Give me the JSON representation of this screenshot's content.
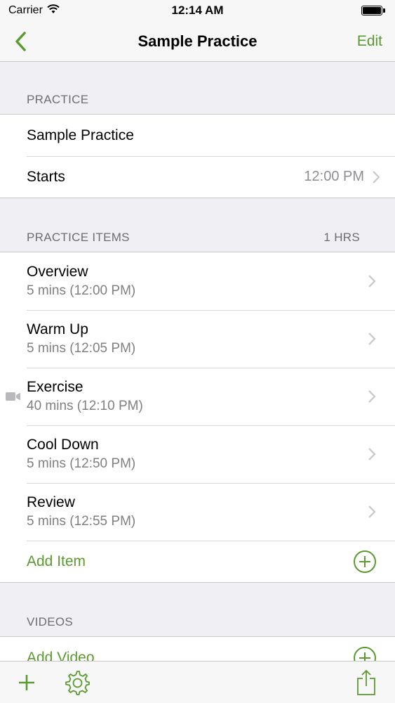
{
  "status_bar": {
    "carrier": "Carrier",
    "time": "12:14 AM"
  },
  "nav": {
    "title": "Sample Practice",
    "edit_label": "Edit"
  },
  "practice_section": {
    "header": "PRACTICE",
    "name": "Sample Practice",
    "starts_label": "Starts",
    "starts_value": "12:00 PM"
  },
  "items_section": {
    "header": "PRACTICE ITEMS",
    "total": "1 HRS",
    "items": [
      {
        "title": "Overview",
        "detail": "5 mins (12:00 PM)"
      },
      {
        "title": "Warm Up",
        "detail": "5 mins (12:05 PM)"
      },
      {
        "title": "Exercise",
        "detail": "40 mins (12:10 PM)"
      },
      {
        "title": "Cool Down",
        "detail": "5 mins (12:50 PM)"
      },
      {
        "title": "Review",
        "detail": "5 mins (12:55 PM)"
      }
    ],
    "add_label": "Add Item"
  },
  "videos_section": {
    "header": "VIDEOS",
    "add_label": "Add Video"
  },
  "colors": {
    "accent": "#5a9a2f",
    "background": "#efeff4",
    "secondary_text": "#808080"
  },
  "icons": [
    "wifi-icon",
    "battery-icon",
    "back-chevron-icon",
    "chevron-right-icon",
    "video-camera-icon",
    "add-circle-icon",
    "plus-icon",
    "gear-icon",
    "share-icon"
  ]
}
